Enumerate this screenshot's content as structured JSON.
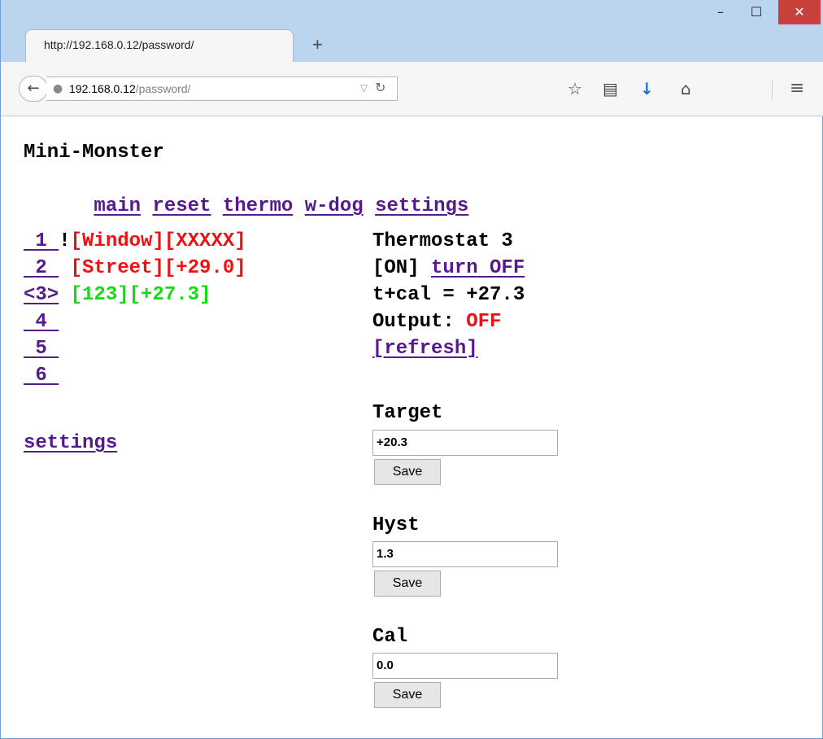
{
  "browser": {
    "tab_title": "http://192.168.0.12/password/",
    "new_tab": "+",
    "window_controls": {
      "minimize": "–",
      "maximize": "☐",
      "close": "✕"
    },
    "url_host": "192.168.0.12",
    "url_path": "/password/",
    "icons": [
      "back-icon",
      "globe-icon",
      "dropdown-icon",
      "reload-icon",
      "star-icon",
      "reader-icon",
      "download-icon",
      "home-icon",
      "menu-icon"
    ]
  },
  "page": {
    "title": "Mini-Monster",
    "nav": [
      "main",
      "reset",
      "thermo",
      "w-dog",
      "settings"
    ],
    "channels": [
      {
        "num": " 1 ",
        "mark": "!",
        "name": "[Window]",
        "value": "[XXXXX]",
        "color": "#ee1111"
      },
      {
        "num": " 2 ",
        "mark": " ",
        "name": "[Street]",
        "value": "[+29.0]",
        "color": "#ee1111"
      },
      {
        "num": "<3>",
        "mark": " ",
        "name": "[123]",
        "value": "[+27.3]",
        "color": "#11dd11"
      },
      {
        "num": " 4 "
      },
      {
        "num": " 5 "
      },
      {
        "num": " 6 "
      }
    ],
    "settings_link": "settings",
    "thermostat": {
      "title": "Thermostat 3",
      "state": "[ON]",
      "toggle": "turn OFF",
      "tcal": "t+cal = +27.3",
      "output_label": "Output:",
      "output_value": "OFF",
      "refresh": "[refresh]"
    },
    "forms": {
      "target_label": "Target",
      "target_value": "+20.3",
      "hyst_label": "Hyst",
      "hyst_value": "1.3",
      "cal_label": "Cal",
      "cal_value": "0.0",
      "save_label": "Save"
    }
  }
}
